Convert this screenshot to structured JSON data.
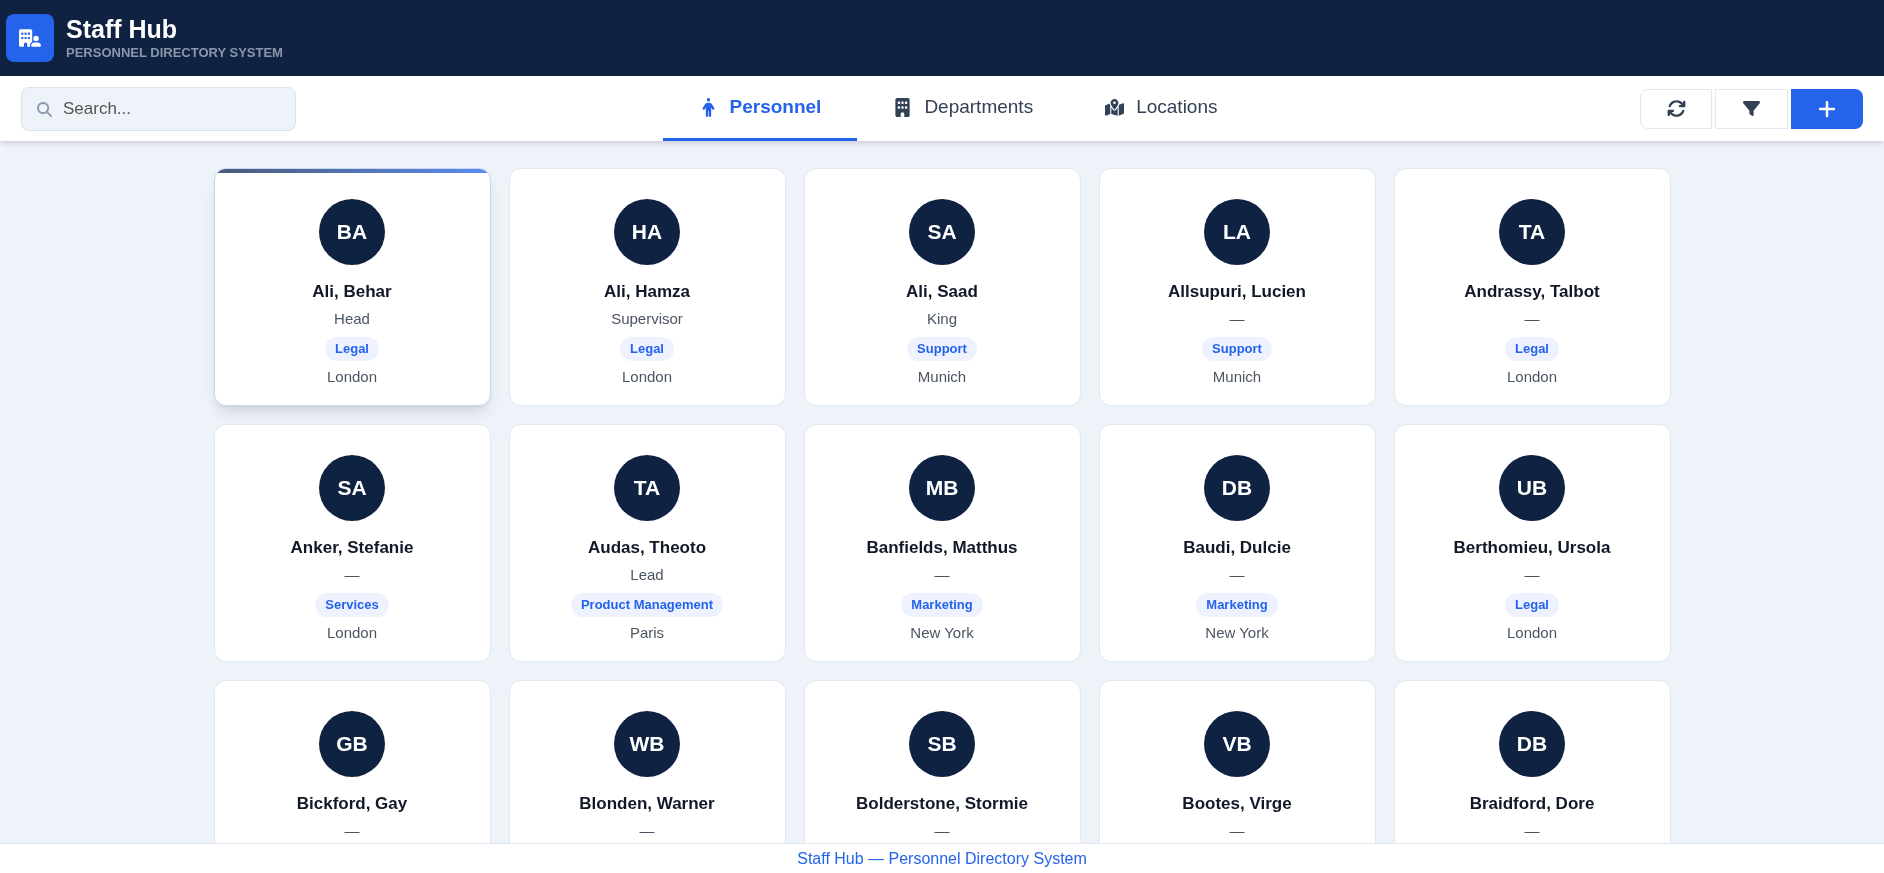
{
  "header": {
    "title": "Staff Hub",
    "subtitle": "PERSONNEL DIRECTORY SYSTEM"
  },
  "search": {
    "placeholder": "Search..."
  },
  "tabs": [
    {
      "label": "Personnel",
      "selected": true,
      "kind": "person"
    },
    {
      "label": "Departments",
      "selected": false,
      "kind": "building"
    },
    {
      "label": "Locations",
      "selected": false,
      "kind": "map"
    }
  ],
  "cards": [
    {
      "initials": "BA",
      "name": "Ali, Behar",
      "role": "Head",
      "department": "Legal",
      "location": "London",
      "highlighted": true
    },
    {
      "initials": "HA",
      "name": "Ali, Hamza",
      "role": "Supervisor",
      "department": "Legal",
      "location": "London",
      "highlighted": false
    },
    {
      "initials": "SA",
      "name": "Ali, Saad",
      "role": "King",
      "department": "Support",
      "location": "Munich",
      "highlighted": false
    },
    {
      "initials": "LA",
      "name": "Allsupuri, Lucien",
      "role": "—",
      "department": "Support",
      "location": "Munich",
      "highlighted": false
    },
    {
      "initials": "TA",
      "name": "Andrassy, Talbot",
      "role": "—",
      "department": "Legal",
      "location": "London",
      "highlighted": false
    },
    {
      "initials": "SA",
      "name": "Anker, Stefanie",
      "role": "—",
      "department": "Services",
      "location": "London",
      "highlighted": false
    },
    {
      "initials": "TA",
      "name": "Audas, Theoto",
      "role": "Lead",
      "department": "Product Management",
      "location": "Paris",
      "highlighted": false
    },
    {
      "initials": "MB",
      "name": "Banfields, Matthus",
      "role": "—",
      "department": "Marketing",
      "location": "New York",
      "highlighted": false
    },
    {
      "initials": "DB",
      "name": "Baudi, Dulcie",
      "role": "—",
      "department": "Marketing",
      "location": "New York",
      "highlighted": false
    },
    {
      "initials": "UB",
      "name": "Berthomieu, Ursola",
      "role": "—",
      "department": "Legal",
      "location": "London",
      "highlighted": false
    },
    {
      "initials": "GB",
      "name": "Bickford, Gay",
      "role": "—",
      "highlighted": false
    },
    {
      "initials": "WB",
      "name": "Blonden, Warner",
      "role": "—",
      "highlighted": false
    },
    {
      "initials": "SB",
      "name": "Bolderstone, Stormie",
      "role": "—",
      "highlighted": false
    },
    {
      "initials": "VB",
      "name": "Bootes, Virge",
      "role": "—",
      "highlighted": false
    },
    {
      "initials": "DB",
      "name": "Braidford, Dore",
      "role": "—",
      "highlighted": false
    }
  ],
  "footer": "Staff Hub — Personnel Directory System"
}
